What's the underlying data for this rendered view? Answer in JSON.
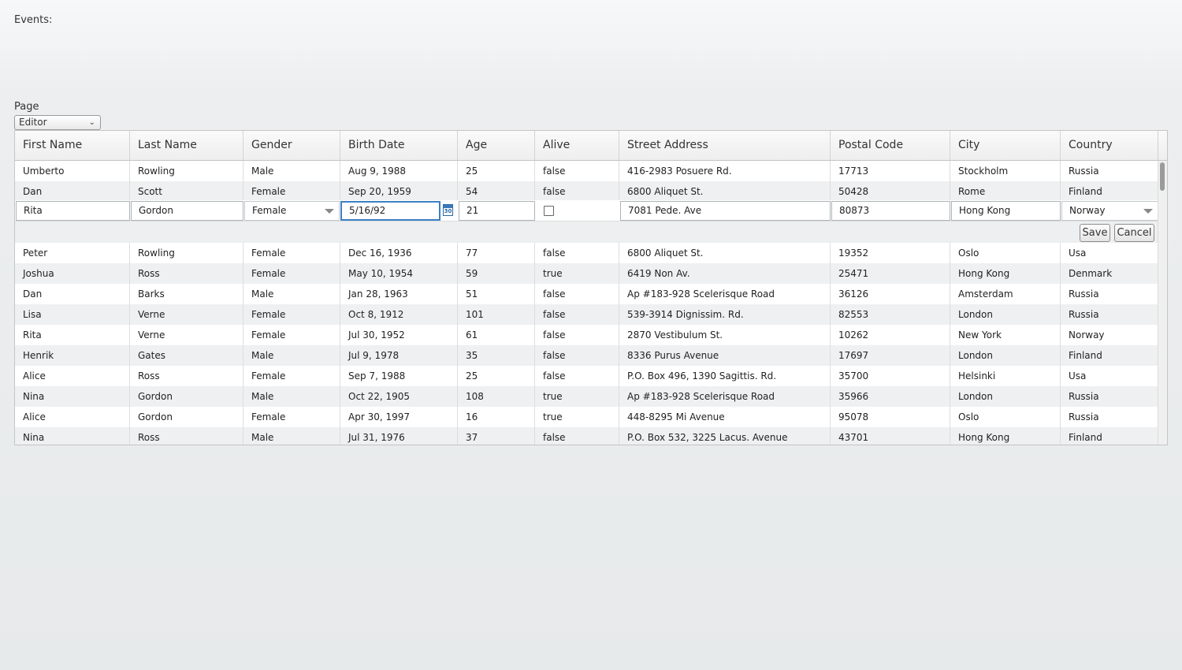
{
  "events": {
    "label": "Events:"
  },
  "page": {
    "label": "Page",
    "selected": "Editor"
  },
  "grid": {
    "columns": [
      "First Name",
      "Last Name",
      "Gender",
      "Birth Date",
      "Age",
      "Alive",
      "Street Address",
      "Postal Code",
      "City",
      "Country"
    ],
    "rows_before_editor": [
      [
        "Umberto",
        "Rowling",
        "Male",
        "Aug 9, 1988",
        "25",
        "false",
        "416-2983 Posuere Rd.",
        "17713",
        "Stockholm",
        "Russia"
      ],
      [
        "Dan",
        "Scott",
        "Female",
        "Sep 20, 1959",
        "54",
        "false",
        "6800 Aliquet St.",
        "50428",
        "Rome",
        "Finland"
      ]
    ],
    "editor": {
      "first_name": "Rita",
      "last_name": "Gordon",
      "gender": "Female",
      "birth_date": "5/16/92",
      "calendar_icon_text": "30",
      "age": "21",
      "alive": false,
      "street_address": "7081 Pede. Ave",
      "postal_code": "80873",
      "city": "Hong Kong",
      "country": "Norway",
      "save_label": "Save",
      "cancel_label": "Cancel"
    },
    "rows_after_editor": [
      [
        "Peter",
        "Rowling",
        "Female",
        "Dec 16, 1936",
        "77",
        "false",
        "6800 Aliquet St.",
        "19352",
        "Oslo",
        "Usa"
      ],
      [
        "Joshua",
        "Ross",
        "Female",
        "May 10, 1954",
        "59",
        "true",
        "6419 Non Av.",
        "25471",
        "Hong Kong",
        "Denmark"
      ],
      [
        "Dan",
        "Barks",
        "Male",
        "Jan 28, 1963",
        "51",
        "false",
        "Ap #183-928 Scelerisque Road",
        "36126",
        "Amsterdam",
        "Russia"
      ],
      [
        "Lisa",
        "Verne",
        "Female",
        "Oct 8, 1912",
        "101",
        "false",
        "539-3914 Dignissim. Rd.",
        "82553",
        "London",
        "Russia"
      ],
      [
        "Rita",
        "Verne",
        "Female",
        "Jul 30, 1952",
        "61",
        "false",
        "2870 Vestibulum St.",
        "10262",
        "New York",
        "Norway"
      ],
      [
        "Henrik",
        "Gates",
        "Male",
        "Jul 9, 1978",
        "35",
        "false",
        "8336 Purus Avenue",
        "17697",
        "London",
        "Finland"
      ],
      [
        "Alice",
        "Ross",
        "Female",
        "Sep 7, 1988",
        "25",
        "false",
        "P.O. Box 496, 1390 Sagittis. Rd.",
        "35700",
        "Helsinki",
        "Usa"
      ],
      [
        "Nina",
        "Gordon",
        "Male",
        "Oct 22, 1905",
        "108",
        "true",
        "Ap #183-928 Scelerisque Road",
        "35966",
        "London",
        "Russia"
      ],
      [
        "Alice",
        "Gordon",
        "Female",
        "Apr 30, 1997",
        "16",
        "true",
        "448-8295 Mi Avenue",
        "95078",
        "Oslo",
        "Russia"
      ],
      [
        "Nina",
        "Ross",
        "Male",
        "Jul 31, 1976",
        "37",
        "false",
        "P.O. Box 532, 3225 Lacus. Avenue",
        "43701",
        "Hong Kong",
        "Finland"
      ]
    ]
  }
}
